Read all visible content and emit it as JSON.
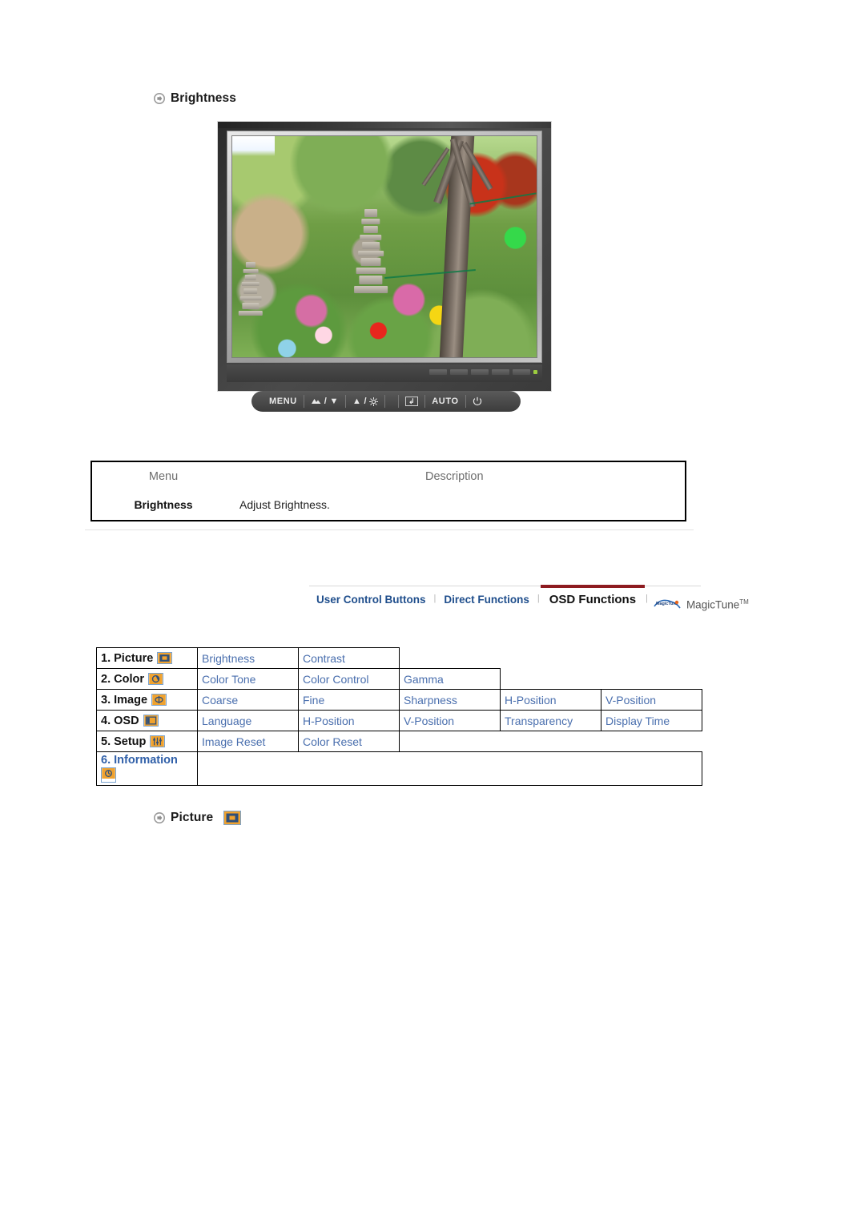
{
  "sections": {
    "brightness_heading": "Brightness",
    "picture_heading": "Picture",
    "bullet_icon": "circle-arrow-icon",
    "picture_icon": "picture-osd-icon"
  },
  "monitor": {
    "name": "lcd-monitor-illustration",
    "screen_image_alt": "Korean garden with stone pagoda, trees and paper lanterns",
    "menu_tick_glyph": "III",
    "buttons": [
      {
        "name": "menu-button",
        "label": "MENU"
      },
      {
        "name": "brightness-down-button",
        "label": "▼"
      },
      {
        "name": "brightness-up-button",
        "label": "▲"
      },
      {
        "name": "enter-button",
        "label": "↲"
      },
      {
        "name": "auto-button",
        "label": "AUTO"
      },
      {
        "name": "power-button",
        "label": "⏻"
      }
    ]
  },
  "menu_table": {
    "headers": {
      "menu": "Menu",
      "description": "Description"
    },
    "rows": [
      {
        "menu": "Brightness",
        "description": "Adjust Brightness."
      }
    ]
  },
  "tabs": {
    "items": [
      {
        "label": "User Control Buttons",
        "active": false
      },
      {
        "label": "Direct Functions",
        "active": false
      },
      {
        "label": "OSD Functions",
        "active": true
      }
    ],
    "separator": "|",
    "magictune": {
      "word": "MagicTune",
      "tm": "TM",
      "mark_text": "MagicTune"
    }
  },
  "osd_matrix": {
    "rows": [
      {
        "label": "1. Picture",
        "icon": "picture-osd-icon",
        "label_blue": false,
        "items": [
          "Brightness",
          "Contrast"
        ]
      },
      {
        "label": "2. Color",
        "icon": "color-osd-icon",
        "label_blue": false,
        "items": [
          "Color Tone",
          "Color Control",
          "Gamma"
        ]
      },
      {
        "label": "3. Image",
        "icon": "image-osd-icon",
        "label_blue": false,
        "items": [
          "Coarse",
          "Fine",
          "Sharpness",
          "H-Position",
          "V-Position"
        ]
      },
      {
        "label": "4. OSD",
        "icon": "osd-osd-icon",
        "label_blue": false,
        "items": [
          "Language",
          "H-Position",
          "V-Position",
          "Transparency",
          "Display Time"
        ]
      },
      {
        "label": "5. Setup",
        "icon": "setup-osd-icon",
        "label_blue": false,
        "items": [
          "Image Reset",
          "Color Reset"
        ]
      },
      {
        "label": "6. Information",
        "icon": "information-osd-icon",
        "label_blue": true,
        "items": []
      }
    ]
  },
  "colors": {
    "link_blue": "#4a6fae",
    "tab_blue": "#1f4e8c",
    "active_tab_underline": "#8d1b20",
    "icon_orange": "#f0a22e",
    "icon_border_blue": "#7aa3cf",
    "rule_gray": "#e3e3e3"
  }
}
